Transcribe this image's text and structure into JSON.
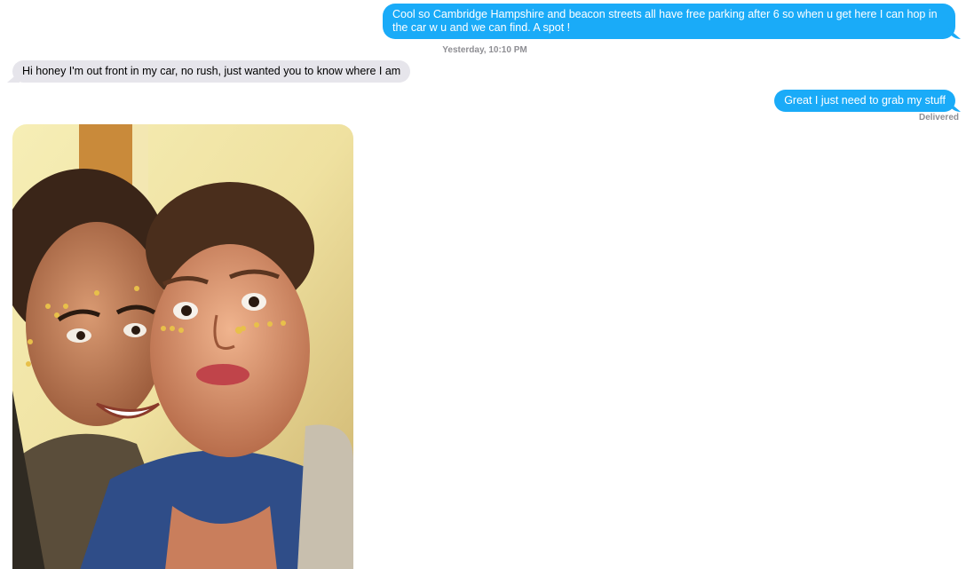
{
  "conversation": {
    "messages": [
      {
        "direction": "outgoing",
        "text": "Cool so Cambridge Hampshire and beacon streets all have free parking after 6 so when u get here I can hop in the car w u and we can find. A spot !"
      },
      {
        "direction": "incoming",
        "text": "Hi honey I'm out front in my car, no rush, just wanted you to know where I am"
      },
      {
        "direction": "outgoing",
        "text": "Great I just need to grab my stuff"
      }
    ],
    "timestamp": "Yesterday, 10:10 PM",
    "delivery_status": "Delivered",
    "photo_attachment": {
      "direction": "incoming",
      "description_icon": "photo-attachment"
    }
  },
  "colors": {
    "outgoing_bubble": "#1aabf8",
    "incoming_bubble": "#e6e5eb",
    "meta_text": "#8e8e93"
  }
}
